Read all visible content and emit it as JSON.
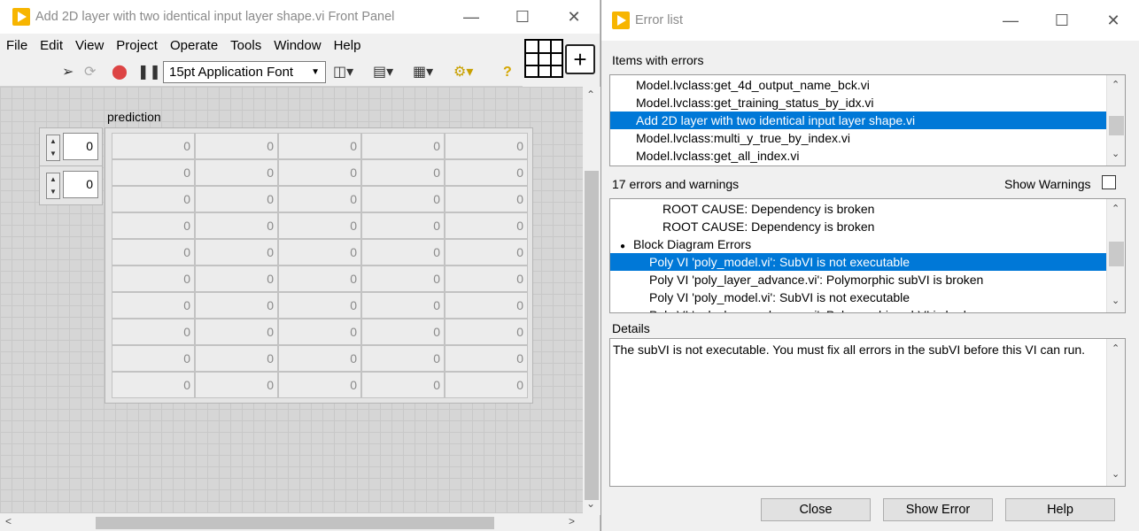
{
  "front_panel": {
    "title": "Add 2D layer with two identical input layer shape.vi Front Panel",
    "menu": [
      "File",
      "Edit",
      "View",
      "Project",
      "Operate",
      "Tools",
      "Window",
      "Help"
    ],
    "font_selector": "15pt Application Font",
    "array_label": "prediction",
    "index0": "0",
    "index1": "0",
    "cells": [
      [
        "0",
        "0",
        "0",
        "0",
        "0"
      ],
      [
        "0",
        "0",
        "0",
        "0",
        "0"
      ],
      [
        "0",
        "0",
        "0",
        "0",
        "0"
      ],
      [
        "0",
        "0",
        "0",
        "0",
        "0"
      ],
      [
        "0",
        "0",
        "0",
        "0",
        "0"
      ],
      [
        "0",
        "0",
        "0",
        "0",
        "0"
      ],
      [
        "0",
        "0",
        "0",
        "0",
        "0"
      ],
      [
        "0",
        "0",
        "0",
        "0",
        "0"
      ],
      [
        "0",
        "0",
        "0",
        "0",
        "0"
      ],
      [
        "0",
        "0",
        "0",
        "0",
        "0"
      ]
    ]
  },
  "error_list": {
    "title": "Error list",
    "items_label": "Items with errors",
    "items": [
      "Model.lvclass:get_4d_output_name_bck.vi",
      "Model.lvclass:get_training_status_by_idx.vi",
      "Add 2D layer with two identical input layer shape.vi",
      "Model.lvclass:multi_y_true_by_index.vi",
      "Model.lvclass:get_all_index.vi"
    ],
    "items_selected": 2,
    "count_label": "17 errors and warnings",
    "show_warnings_label": "Show Warnings",
    "errors": [
      {
        "text": "ROOT CAUSE: Dependency is broken",
        "indent": 2,
        "bullet": false
      },
      {
        "text": "ROOT CAUSE: Dependency is broken",
        "indent": 2,
        "bullet": false
      },
      {
        "text": "Block Diagram Errors",
        "indent": 0,
        "bullet": true
      },
      {
        "text": "Poly VI 'poly_model.vi': SubVI is not executable",
        "indent": 1,
        "bullet": false
      },
      {
        "text": "Poly VI 'poly_layer_advance.vi': Polymorphic subVI is broken",
        "indent": 1,
        "bullet": false
      },
      {
        "text": "Poly VI 'poly_model.vi': SubVI is not executable",
        "indent": 1,
        "bullet": false
      },
      {
        "text": "Poly VI 'poly_layer_advance.vi': Polymorphic subVI is broken",
        "indent": 1,
        "bullet": false
      }
    ],
    "errors_selected": 3,
    "details_label": "Details",
    "details_text": "The subVI is not executable. You must fix all errors in the subVI before this VI can run.",
    "buttons": {
      "close": "Close",
      "show_error": "Show Error",
      "help": "Help"
    }
  },
  "colors": {
    "selection": "#0078d7",
    "labview_icon": "#f7b500"
  }
}
